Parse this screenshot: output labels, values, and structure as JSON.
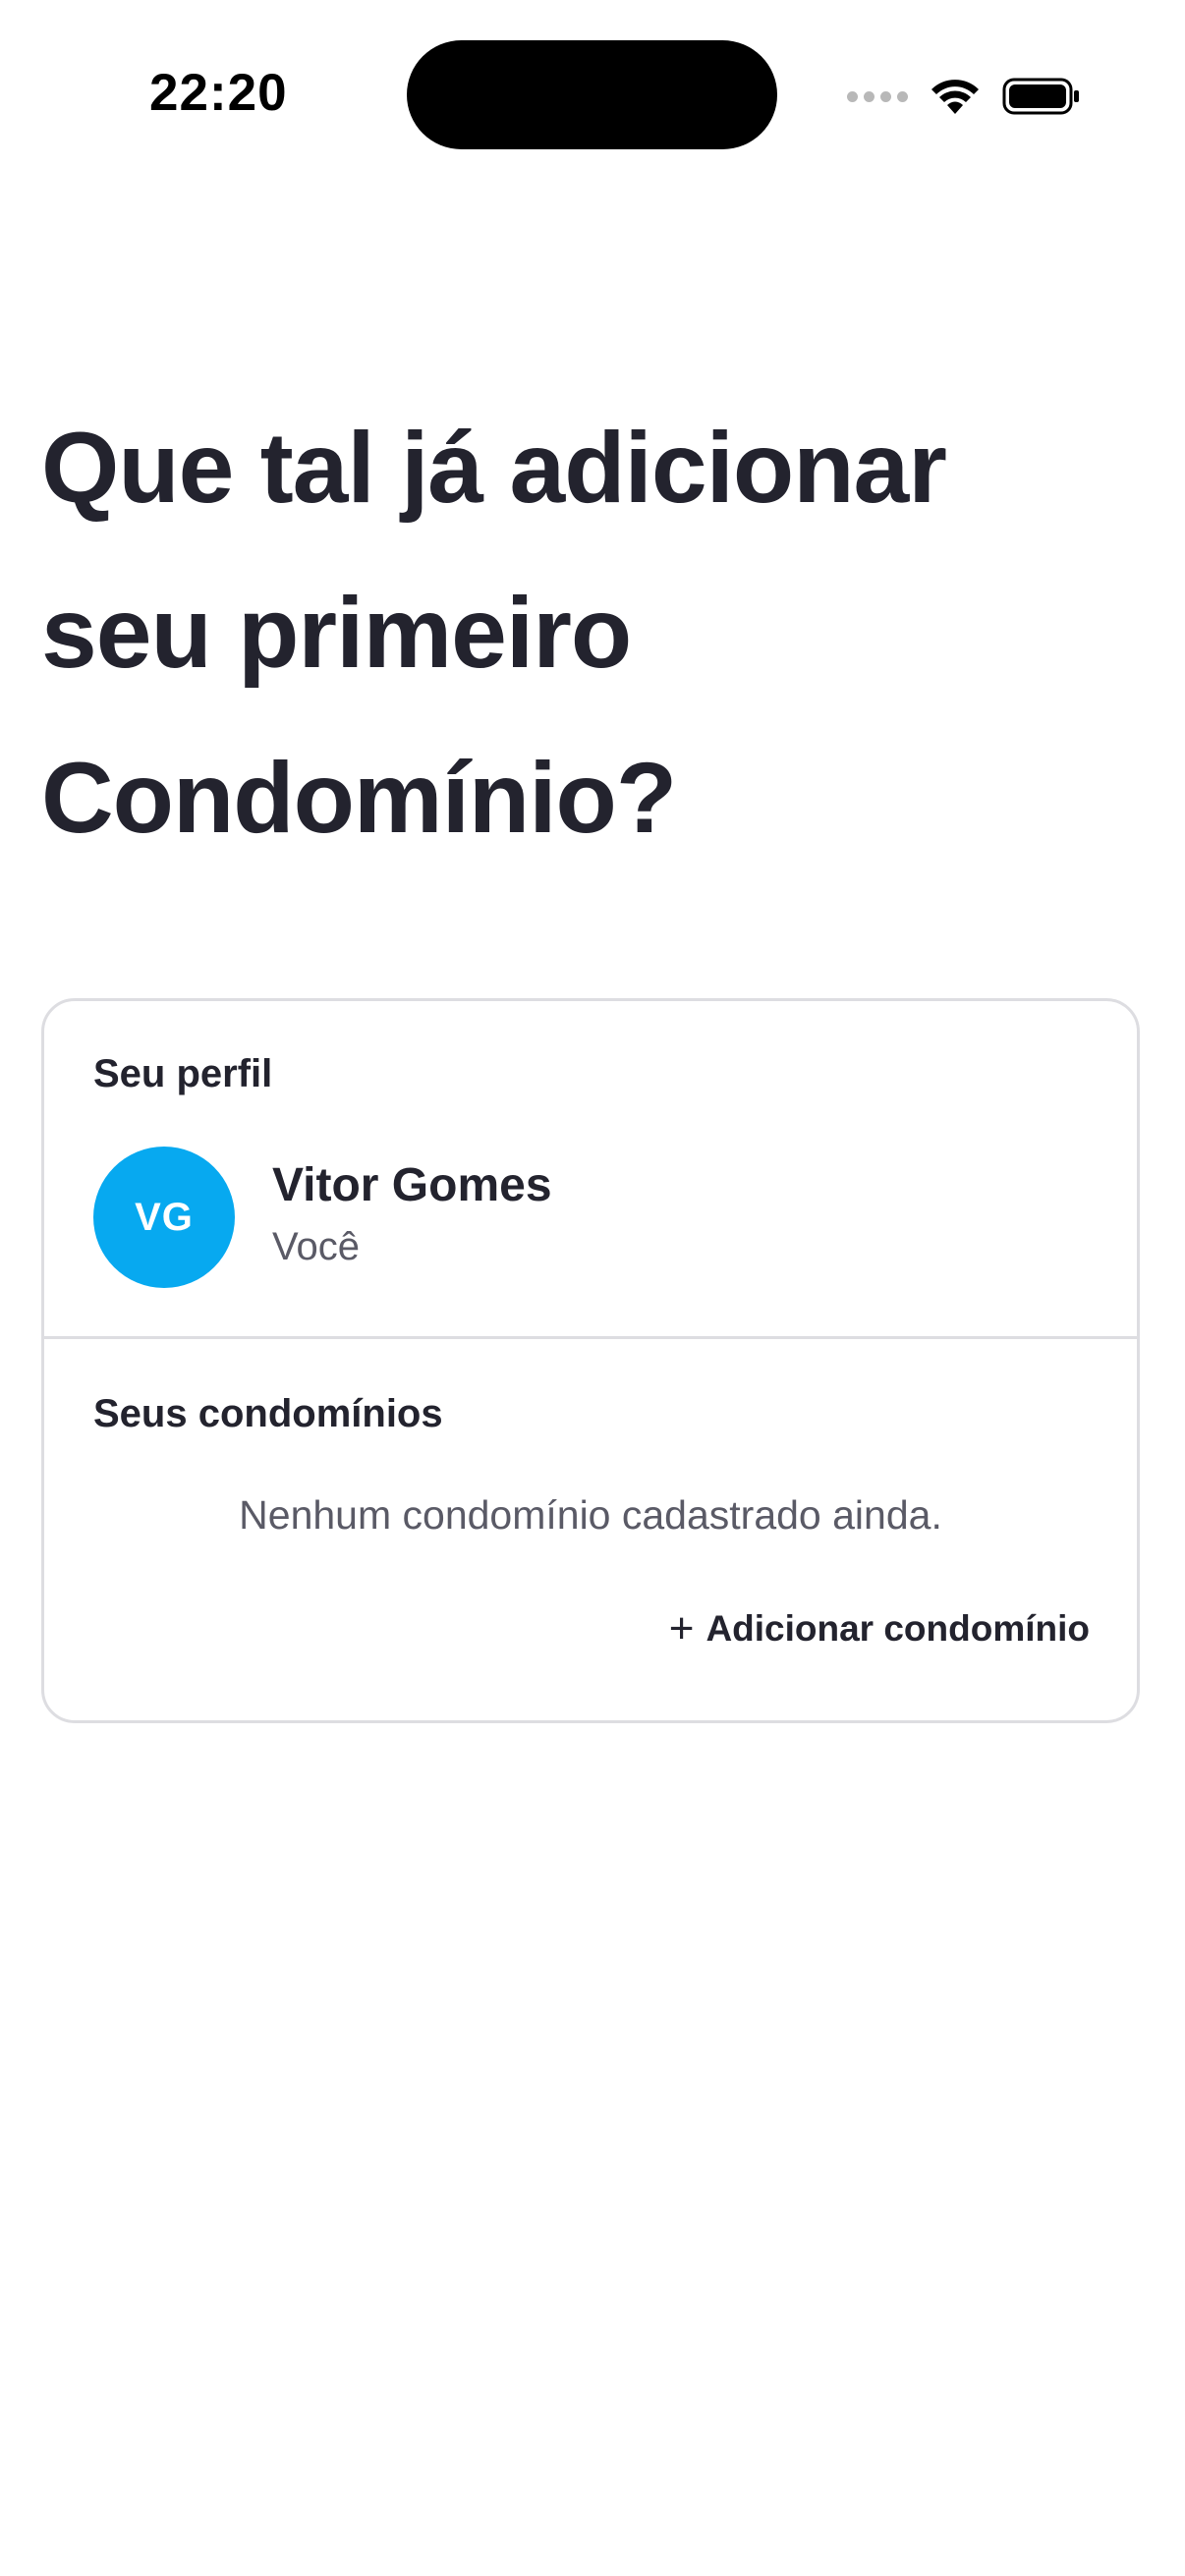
{
  "status_bar": {
    "time": "22:20",
    "icons": [
      "signal-icon",
      "wifi-icon",
      "battery-icon"
    ]
  },
  "headline": {
    "lines": [
      "Que tal já adicionar",
      "seu primeiro",
      "Condomínio?"
    ]
  },
  "card": {
    "profile": {
      "title": "Seu perfil",
      "avatar_initials": "VG",
      "avatar_color": "#07a9f0",
      "name": "Vitor Gomes",
      "role": "Você"
    },
    "condos": {
      "title": "Seus condomínios",
      "empty_text": "Nenhum condomínio cadastrado ainda.",
      "add_icon": "+",
      "add_label": "Adicionar condomínio"
    }
  }
}
